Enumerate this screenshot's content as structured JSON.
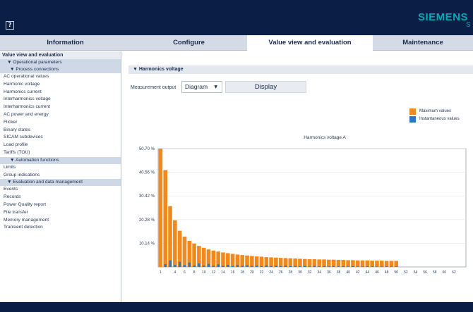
{
  "header": {
    "help_glyph": "?",
    "brand": "SIEMENS",
    "brand_tail": "S"
  },
  "tabs": [
    {
      "id": "information",
      "label": "Information",
      "active": false
    },
    {
      "id": "configure",
      "label": "Configure",
      "active": false
    },
    {
      "id": "value_view",
      "label": "Value view and evaluation",
      "active": true
    },
    {
      "id": "maintenance",
      "label": "Maintenance",
      "active": false
    }
  ],
  "sidebar": {
    "title": "Value view and evaluation",
    "operational_group": "▼ Operational parameters",
    "process_group": "▼ Process connections",
    "process_items": [
      "AC operational values",
      "Harmonic voltage",
      "Harmonics current",
      "Interharmonics voltage",
      "Interharmonics current",
      "AC power and energy",
      "Flicker",
      "Binary states",
      "SICAM subdevices",
      "Load profile",
      "Tariffs (TOU)"
    ],
    "automation_group": "▼ Automation functions",
    "automation_items": [
      "Limits",
      "Group indications"
    ],
    "evaluation_group": "▼ Evaluation and data management",
    "evaluation_items": [
      "Events",
      "Records",
      "Power Quality report",
      "File transfer",
      "Memory management",
      "Transient detection"
    ]
  },
  "main": {
    "section_title": "▼ Harmonics voltage",
    "measurement_label": "Measurement output",
    "measurement_value": "Diagram",
    "select_arrow": "▼",
    "display_label": "Display"
  },
  "legend": [
    {
      "label": "Maximum values",
      "color": "#f08a1e"
    },
    {
      "label": "Instantaneous values",
      "color": "#2a78c0"
    }
  ],
  "chart_data": {
    "type": "bar",
    "title": "Harmonics voltage A",
    "ytick_labels": [
      "50.70 %",
      "40.56 %",
      "30.42 %",
      "20.28 %",
      "10.14 %"
    ],
    "ytick_values": [
      50.7,
      40.56,
      30.42,
      20.28,
      10.14
    ],
    "ylim": [
      0,
      50.7
    ],
    "xlim": [
      1,
      64
    ],
    "xtick_labels": [
      "1",
      "4",
      "6",
      "8",
      "10",
      "12",
      "14",
      "16",
      "18",
      "20",
      "22",
      "24",
      "26",
      "28",
      "30",
      "32",
      "34",
      "36",
      "38",
      "40",
      "42",
      "44",
      "46",
      "48",
      "50",
      "52",
      "54",
      "56",
      "58",
      "60",
      "62"
    ],
    "orders": [
      1,
      2,
      3,
      4,
      5,
      6,
      7,
      8,
      9,
      10,
      11,
      12,
      13,
      14,
      15,
      16,
      17,
      18,
      19,
      20,
      21,
      22,
      23,
      24,
      25,
      26,
      27,
      28,
      29,
      30,
      31,
      32,
      33,
      34,
      35,
      36,
      37,
      38,
      39,
      40,
      41,
      42,
      43,
      44,
      45,
      46,
      47,
      48,
      49,
      50
    ],
    "series": [
      {
        "name": "Maximum values",
        "color": "#f08a1e",
        "values": [
          50.7,
          41.5,
          26.0,
          20.0,
          15.5,
          13.0,
          11.2,
          10.0,
          9.0,
          8.2,
          7.5,
          7.0,
          6.6,
          6.2,
          5.9,
          5.6,
          5.3,
          5.1,
          4.9,
          4.7,
          4.5,
          4.4,
          4.2,
          4.1,
          4.0,
          3.9,
          3.8,
          3.7,
          3.6,
          3.5,
          3.4,
          3.3,
          3.3,
          3.2,
          3.2,
          3.1,
          3.1,
          3.0,
          3.0,
          2.9,
          2.9,
          2.8,
          2.8,
          2.8,
          2.7,
          2.7,
          2.7,
          2.6,
          2.6,
          2.6
        ]
      },
      {
        "name": "Instantaneous values",
        "color": "#2a78c0",
        "values": [
          0.0,
          1.2,
          2.8,
          0.9,
          2.2,
          0.8,
          1.9,
          0.6,
          1.5,
          0.6,
          1.3,
          0.5,
          1.1,
          0.5,
          0.9,
          0.4,
          0.8,
          0.4,
          0.7,
          0.4,
          0.6,
          0.3,
          0.6,
          0.3,
          0.5,
          0.3,
          0.5,
          0.3,
          0.4,
          0.3,
          0.4,
          0.2,
          0.4,
          0.2,
          0.3,
          0.2,
          0.3,
          0.2,
          0.3,
          0.2,
          0.3,
          0.2,
          0.2,
          0.2,
          0.2,
          0.2,
          0.2,
          0.2,
          0.2,
          0.2
        ]
      }
    ],
    "grid": true
  }
}
